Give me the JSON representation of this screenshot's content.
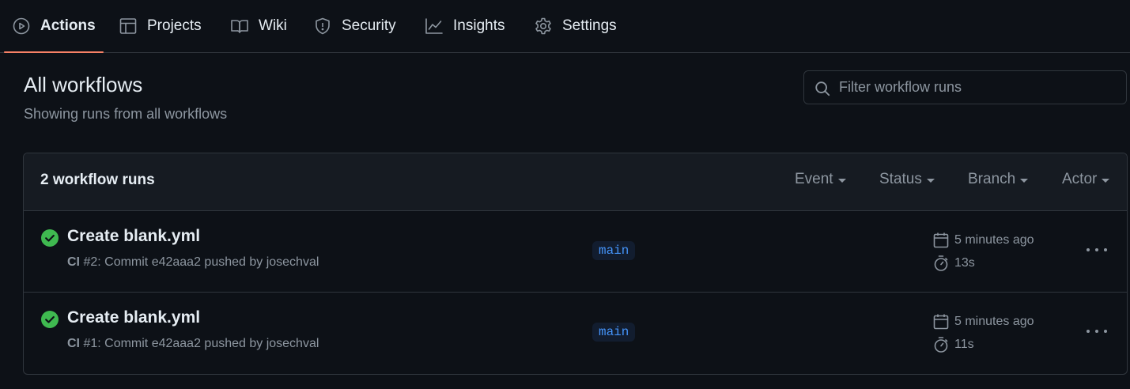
{
  "nav": {
    "tabs": [
      {
        "label": "Actions",
        "icon": "play-circle-icon",
        "active": true
      },
      {
        "label": "Projects",
        "icon": "table-icon",
        "active": false
      },
      {
        "label": "Wiki",
        "icon": "book-icon",
        "active": false
      },
      {
        "label": "Security",
        "icon": "shield-icon",
        "active": false
      },
      {
        "label": "Insights",
        "icon": "graph-icon",
        "active": false
      },
      {
        "label": "Settings",
        "icon": "gear-icon",
        "active": false
      }
    ],
    "accent_color": "#f78166"
  },
  "header": {
    "title": "All workflows",
    "subtitle": "Showing runs from all workflows"
  },
  "search": {
    "placeholder": "Filter workflow runs",
    "value": ""
  },
  "runs": {
    "count_label": "2 workflow runs",
    "filters": [
      "Event",
      "Status",
      "Branch",
      "Actor"
    ],
    "items": [
      {
        "status": "success",
        "status_color": "#3fb950",
        "title": "Create blank.yml",
        "workflow": "CI",
        "meta": " #2: Commit e42aaa2 pushed by josechval",
        "branch": "main",
        "time_ago": "5 minutes ago",
        "duration": "13s"
      },
      {
        "status": "success",
        "status_color": "#3fb950",
        "title": "Create blank.yml",
        "workflow": "CI",
        "meta": " #1: Commit e42aaa2 pushed by josechval",
        "branch": "main",
        "time_ago": "5 minutes ago",
        "duration": "11s"
      }
    ]
  }
}
